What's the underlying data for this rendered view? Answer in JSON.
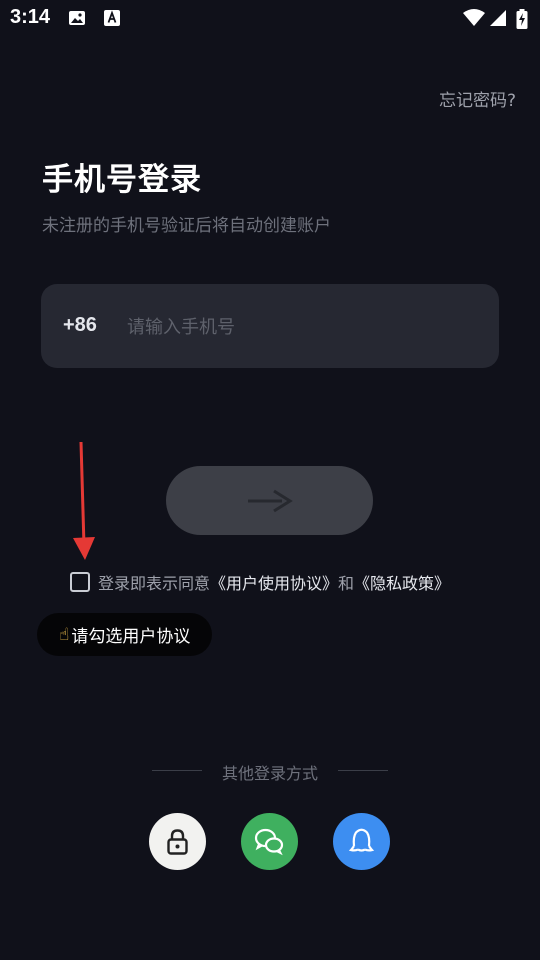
{
  "status_bar": {
    "time": "3:14",
    "icons": [
      "image-icon",
      "a-icon",
      "wifi-icon",
      "signal-icon",
      "battery-charging-icon"
    ]
  },
  "header": {
    "forgot_password": "忘记密码?"
  },
  "main": {
    "title": "手机号登录",
    "subtitle": "未注册的手机号验证后将自动创建账户",
    "country_code": "+86",
    "phone_placeholder": "请输入手机号",
    "phone_value": ""
  },
  "agreement": {
    "prefix": "登录即表示同意",
    "user_agreement": "《用户使用协议》",
    "conjunction": "和",
    "privacy_policy": "《隐私政策》",
    "checked": false
  },
  "tooltip": {
    "icon": "pointing-hand-icon",
    "text": "请勾选用户协议"
  },
  "other_login": {
    "label": "其他登录方式",
    "methods": [
      {
        "name": "password-login",
        "icon": "lock-icon",
        "color": "#f2f2f0"
      },
      {
        "name": "wechat-login",
        "icon": "wechat-icon",
        "color": "#3fb05f"
      },
      {
        "name": "qq-login",
        "icon": "qq-icon",
        "color": "#3d8ef1"
      }
    ]
  },
  "colors": {
    "background": "#10111a",
    "input_background": "#262832",
    "button_disabled": "#3d3f47",
    "hint_arrow": "#e53935"
  }
}
